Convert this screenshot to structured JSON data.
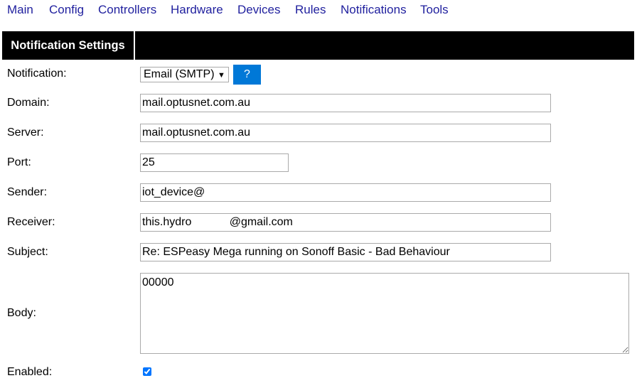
{
  "nav": [
    "Main",
    "Config",
    "Controllers",
    "Hardware",
    "Devices",
    "Rules",
    "Notifications",
    "Tools"
  ],
  "header": {
    "title": "Notification Settings"
  },
  "form": {
    "notification": {
      "label": "Notification:",
      "value": "Email (SMTP)",
      "help": "?"
    },
    "domain": {
      "label": "Domain:",
      "value": "mail.optusnet.com.au"
    },
    "server": {
      "label": "Server:",
      "value": "mail.optusnet.com.au"
    },
    "port": {
      "label": "Port:",
      "value": "25"
    },
    "sender": {
      "label": "Sender:",
      "value": "iot_device@"
    },
    "receiver": {
      "label": "Receiver:",
      "value": "this.hydro            @gmail.com"
    },
    "subject": {
      "label": "Subject:",
      "value": "Re: ESPeasy Mega running on Sonoff Basic - Bad Behaviour"
    },
    "body": {
      "label": "Body:",
      "value": "00000"
    },
    "enabled": {
      "label": "Enabled:",
      "checked": true
    }
  }
}
